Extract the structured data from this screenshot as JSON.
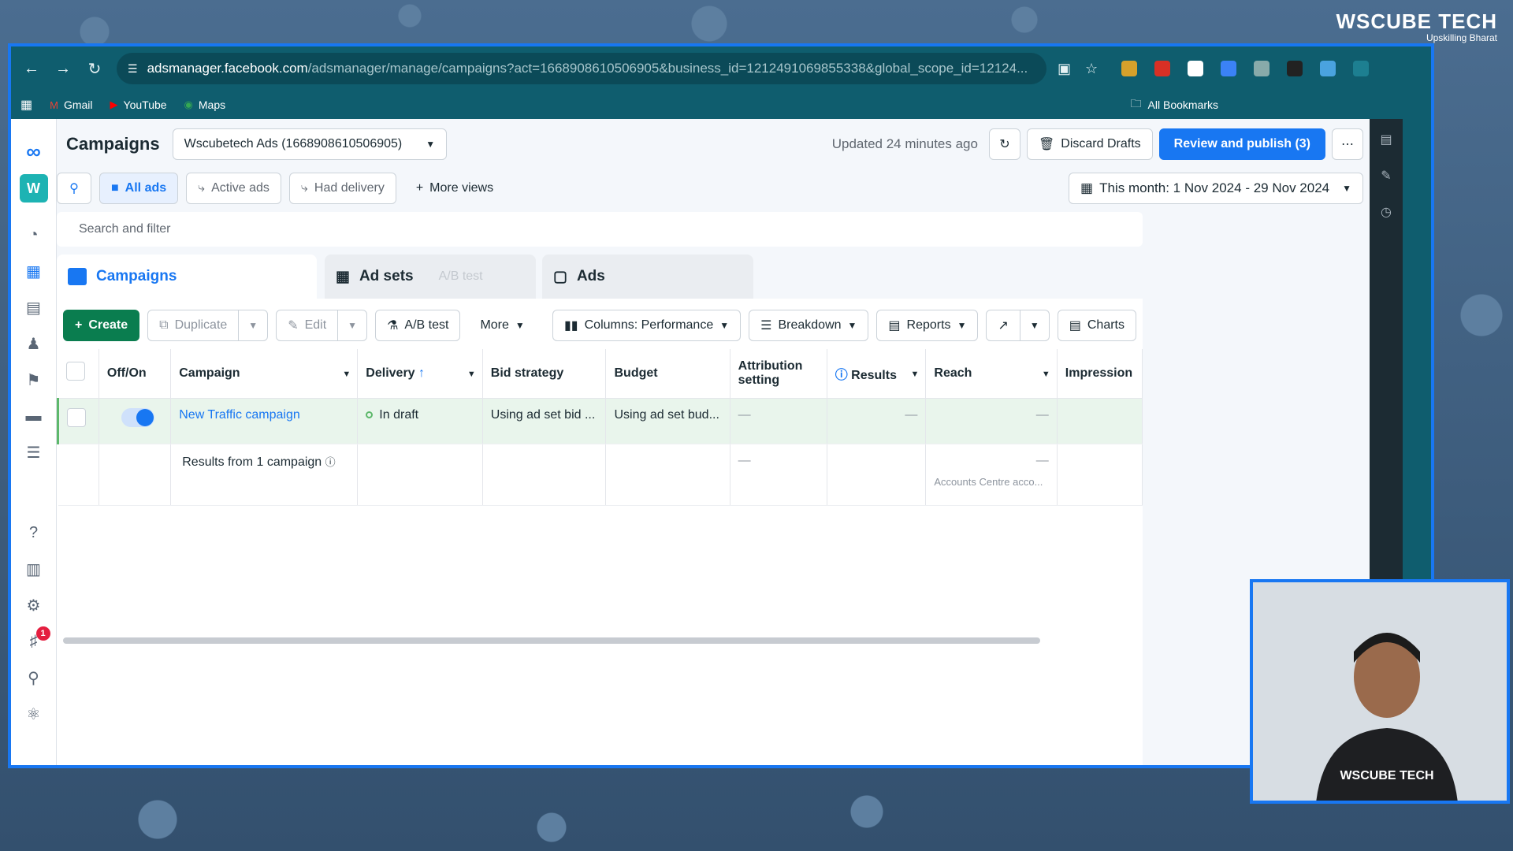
{
  "browser": {
    "url_host": "adsmanager.facebook.com",
    "url_path": "/adsmanager/manage/campaigns?act=1668908610506905&business_id=1212491069855338&global_scope_id=12124...",
    "bookmarks": [
      "Gmail",
      "YouTube",
      "Maps"
    ],
    "all_bookmarks": "All Bookmarks"
  },
  "brand": {
    "name": "WSCUBE TECH",
    "tagline": "Upskilling Bharat"
  },
  "header": {
    "title": "Campaigns",
    "account": "Wscubetech Ads (1668908610506905)",
    "updated": "Updated 24 minutes ago",
    "discard": "Discard Drafts",
    "publish": "Review and publish (3)"
  },
  "views": {
    "all_ads": "All ads",
    "active_ads": "Active ads",
    "had_delivery": "Had delivery",
    "more_views": "More views",
    "date_range": "This month: 1 Nov 2024 - 29 Nov 2024"
  },
  "search": {
    "placeholder": "Search and filter"
  },
  "tabs": {
    "campaigns": "Campaigns",
    "adsets": "Ad sets",
    "abtest": "A/B test",
    "ads": "Ads"
  },
  "toolbar": {
    "create": "Create",
    "duplicate": "Duplicate",
    "edit": "Edit",
    "ab_test": "A/B test",
    "more": "More",
    "columns": "Columns: Performance",
    "breakdown": "Breakdown",
    "reports": "Reports",
    "charts": "Charts"
  },
  "table": {
    "headers": {
      "offon": "Off/On",
      "campaign": "Campaign",
      "delivery": "Delivery",
      "bid": "Bid strategy",
      "budget": "Budget",
      "attribution": "Attribution setting",
      "results": "Results",
      "reach": "Reach",
      "impression": "Impression"
    },
    "row": {
      "campaign": "New Traffic campaign",
      "delivery": "In draft",
      "bid": "Using ad set bid ...",
      "budget": "Using ad set bud...",
      "attribution": "—",
      "results": "—",
      "reach": "—"
    },
    "summary": {
      "label": "Results from 1 campaign",
      "attribution": "—",
      "reach": "—",
      "reach_note": "Accounts Centre acco..."
    }
  },
  "notifications": {
    "count": "1"
  },
  "colors": {
    "accent": "#1877f2",
    "create": "#0a7d4f",
    "browser": "#0f5d6e"
  }
}
